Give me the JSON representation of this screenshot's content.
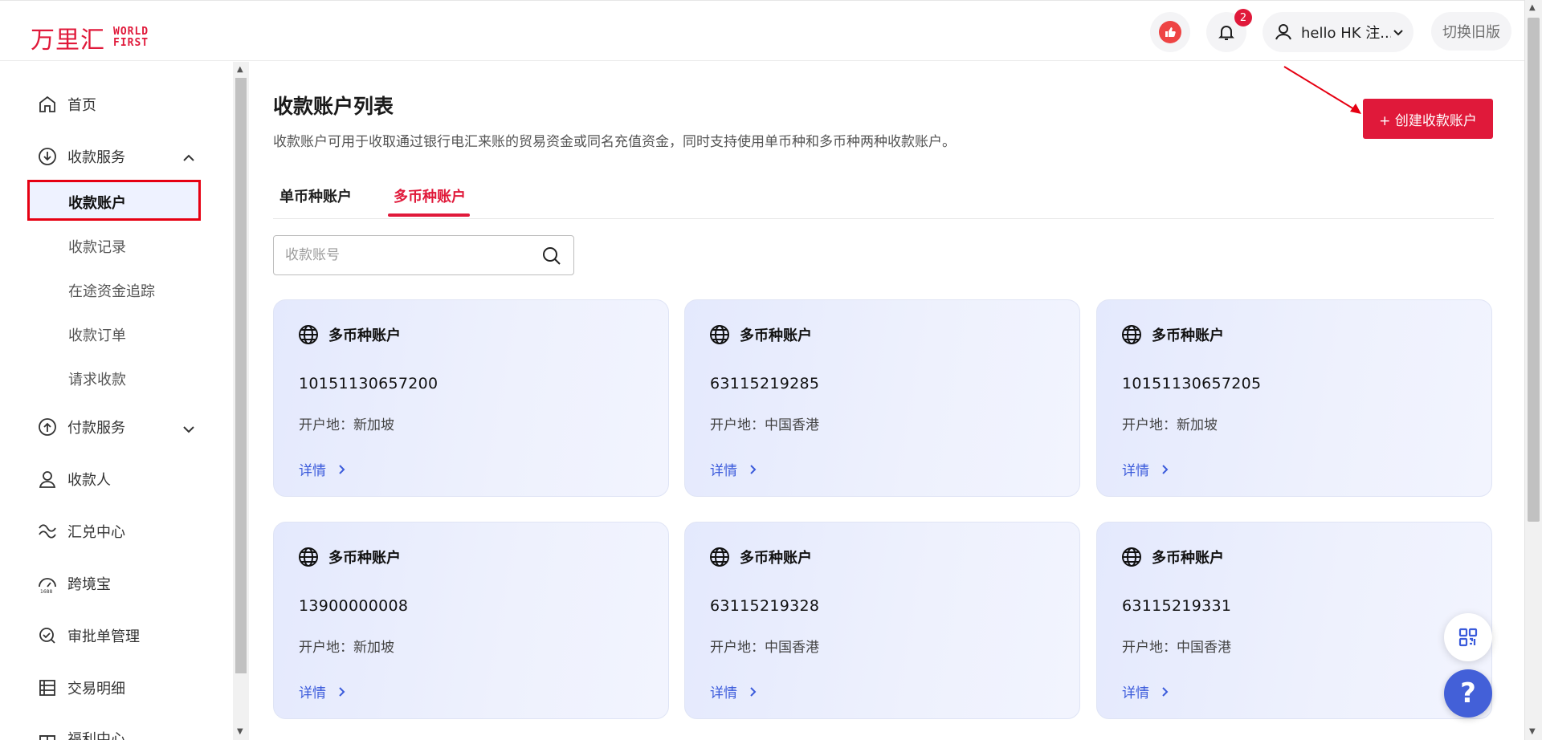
{
  "brand": {
    "logo_cn": "万里汇",
    "logo_en_line1": "WORLD",
    "logo_en_line2": "FIRST",
    "accent": "#e0193a"
  },
  "header": {
    "notification_count": "2",
    "user_name": "hello HK 注...",
    "switch_old": "切换旧版",
    "icons": [
      "thumbs-up-icon",
      "bell-icon",
      "user-icon",
      "chevron-down-icon"
    ]
  },
  "sidebar": {
    "items": [
      {
        "label": "首页",
        "icon": "home-icon"
      },
      {
        "label": "收款服务",
        "icon": "download-circle-icon",
        "expanded": true
      },
      {
        "label": "付款服务",
        "icon": "upload-circle-icon",
        "expanded": false
      },
      {
        "label": "收款人",
        "icon": "person-icon"
      },
      {
        "label": "汇兑中心",
        "icon": "exchange-icon"
      },
      {
        "label": "跨境宝",
        "icon": "gauge-1688-icon"
      },
      {
        "label": "审批单管理",
        "icon": "approval-icon"
      },
      {
        "label": "交易明细",
        "icon": "list-icon"
      },
      {
        "label": "福利中心",
        "icon": "gift-icon"
      }
    ],
    "sub_items": [
      "收款账户",
      "收款记录",
      "在途资金追踪",
      "收款订单",
      "请求收款"
    ],
    "active_sub": "收款账户"
  },
  "main": {
    "title": "收款账户列表",
    "description": "收款账户可用于收取通过银行电汇来账的贸易资金或同名充值资金，同时支持使用单币种和多币种两种收款账户。",
    "create_button": "+ 创建收款账户",
    "tabs": [
      "单币种账户",
      "多币种账户"
    ],
    "active_tab": "多币种账户",
    "search_placeholder": "收款账号",
    "cards": [
      {
        "title": "多币种账户",
        "number": "10151130657200",
        "location": "开户地：新加坡",
        "detail": "详情"
      },
      {
        "title": "多币种账户",
        "number": "63115219285",
        "location": "开户地：中国香港",
        "detail": "详情"
      },
      {
        "title": "多币种账户",
        "number": "10151130657205",
        "location": "开户地：新加坡",
        "detail": "详情"
      },
      {
        "title": "多币种账户",
        "number": "13900000008",
        "location": "开户地：新加坡",
        "detail": "详情"
      },
      {
        "title": "多币种账户",
        "number": "63115219328",
        "location": "开户地：中国香港",
        "detail": "详情"
      },
      {
        "title": "多币种账户",
        "number": "63115219331",
        "location": "开户地：中国香港",
        "detail": "详情"
      }
    ]
  },
  "floating": {
    "help": "?"
  }
}
